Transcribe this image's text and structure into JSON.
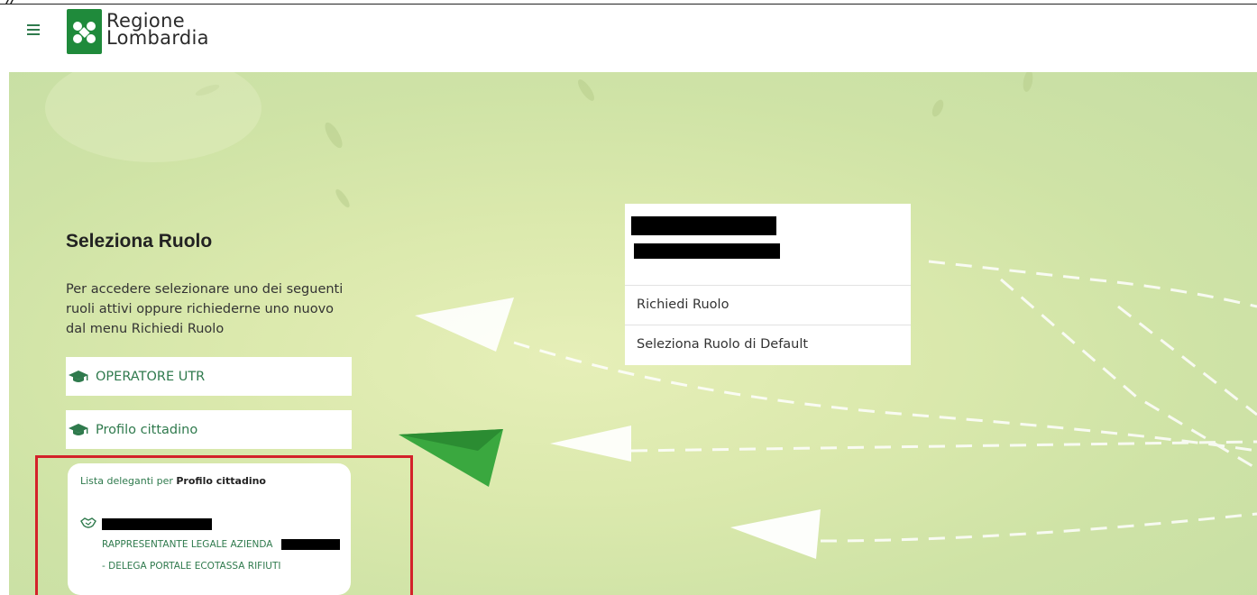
{
  "header": {
    "logo_line1": "Regione",
    "logo_line2": "Lombardia",
    "menu_icon": "hamburger-menu-icon",
    "logo_icon": "regione-lombardia-logo-icon"
  },
  "colors": {
    "brand_green": "#1f8a3b",
    "link_green": "#2f7a4d",
    "highlight_red": "#d3222a"
  },
  "main": {
    "title": "Seleziona Ruolo",
    "description": "Per accedere selezionare uno dei seguenti ruoli attivi oppure richiederne uno nuovo dal menu Richiedi Ruolo",
    "roles": [
      {
        "label": "OPERATORE UTR",
        "icon": "graduation-cap-icon"
      },
      {
        "label": "Profilo cittadino",
        "icon": "graduation-cap-icon"
      }
    ],
    "delegates": {
      "title_prefix": "Lista deleganti per",
      "title_profile": "Profilo cittadino",
      "icon": "handshake-icon",
      "line1": "RAPPRESENTANTE LEGALE AZIENDA",
      "line2": "- DELEGA PORTALE ECOTASSA RIFIUTI"
    }
  },
  "user_menu": {
    "items": [
      "Richiedi Ruolo",
      "Seleziona Ruolo di Default"
    ]
  }
}
